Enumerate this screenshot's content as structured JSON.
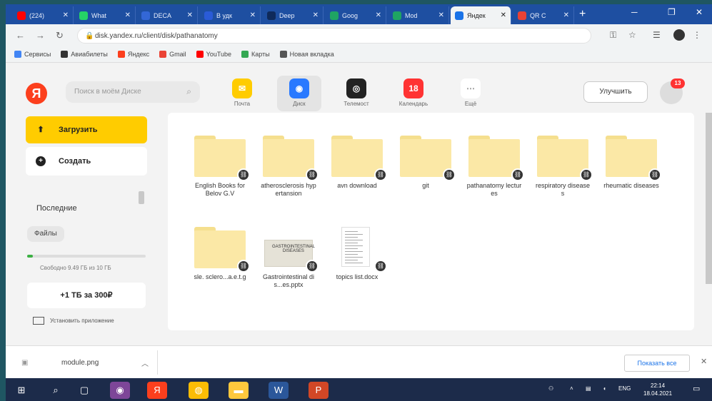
{
  "browser": {
    "tabs": [
      {
        "title": "(224)",
        "favicon_color": "#ff0000",
        "active": false
      },
      {
        "title": "What",
        "favicon_color": "#25d366",
        "active": false
      },
      {
        "title": "DECA",
        "favicon_color": "#3367d6",
        "active": false
      },
      {
        "title": "В удк",
        "favicon_color": "#2a5bd7",
        "active": false
      },
      {
        "title": "Deep",
        "favicon_color": "#0f2a5a",
        "active": false
      },
      {
        "title": "Goog",
        "favicon_color": "#1fa463",
        "active": false
      },
      {
        "title": "Mod",
        "favicon_color": "#1fa463",
        "active": false
      },
      {
        "title": "Яндек",
        "favicon_color": "#1a73e8",
        "active": true
      },
      {
        "title": "QR C",
        "favicon_color": "#e94235",
        "active": false
      }
    ],
    "new_tab_symbol": "+",
    "window_controls": {
      "minimize": "─",
      "restore": "❐",
      "close": "✕"
    },
    "url": "disk.yandex.ru/client/disk/pathanatomy",
    "bookmarks": [
      {
        "label": "Сервисы",
        "icon": "grid-icon",
        "color": "#4285f4"
      },
      {
        "label": "Авиабилеты",
        "icon": "plane-icon",
        "color": "#333333"
      },
      {
        "label": "Яндекс",
        "icon": "yandex-icon",
        "color": "#fc3f1d"
      },
      {
        "label": "Gmail",
        "icon": "gmail-icon",
        "color": "#ea4335"
      },
      {
        "label": "YouTube",
        "icon": "youtube-icon",
        "color": "#ff0000"
      },
      {
        "label": "Карты",
        "icon": "maps-icon",
        "color": "#34a853"
      },
      {
        "label": "Новая вкладка",
        "icon": "globe-icon",
        "color": "#555555"
      }
    ]
  },
  "header": {
    "logo": "Я",
    "search_placeholder": "Поиск в моём Диске",
    "services": [
      {
        "label": "Почта",
        "icon": "mail-icon",
        "color": "#ffcc00",
        "active": false
      },
      {
        "label": "Диск",
        "icon": "disk-icon",
        "color": "#2979ff",
        "active": true
      },
      {
        "label": "Телемост",
        "icon": "telemost-icon",
        "color": "#222222",
        "active": false
      },
      {
        "label": "Календарь",
        "icon": "calendar-icon",
        "color": "#f33",
        "badge": "18",
        "active": false
      },
      {
        "label": "Ещё",
        "icon": "more-icon",
        "color": "#ffffff",
        "active": false
      }
    ],
    "improve_button": "Улучшить",
    "avatar_badge": "13"
  },
  "sidebar": {
    "upload": "Загрузить",
    "create": "Создать",
    "recent": "Последние",
    "files": "Файлы",
    "storage_text": "Свободно 9.49 ГБ из 10 ГБ",
    "storage_used_fraction": 0.05,
    "storage_color": "#3cb043",
    "buy_more": "+1 ТБ за 300₽",
    "install_app": "Установить приложение"
  },
  "files": [
    {
      "type": "folder",
      "name": "English Books for Belov G.V"
    },
    {
      "type": "folder",
      "name": "atherosclerosis hypertansion"
    },
    {
      "type": "folder",
      "name": "avn download"
    },
    {
      "type": "folder",
      "name": "git"
    },
    {
      "type": "folder",
      "name": "pathanatomy lectures"
    },
    {
      "type": "folder",
      "name": "respiratory diseases"
    },
    {
      "type": "folder",
      "name": "rheumatic diseases"
    },
    {
      "type": "folder",
      "name": "sle. sclero...a.e.t.g"
    },
    {
      "type": "pptx",
      "name": "Gastrointestinal dis...es.pptx",
      "preview_text": "GASTROINTESTINAL DISEASES"
    },
    {
      "type": "docx",
      "name": "topics list.docx"
    }
  ],
  "download_bar": {
    "file": "module.png",
    "show_all": "Показать все"
  },
  "taskbar": {
    "apps": [
      "windows-icon",
      "search-icon",
      "taskview-icon",
      "tor-icon",
      "yandex-browser-icon",
      "chrome-icon",
      "explorer-icon",
      "word-icon",
      "powerpoint-icon"
    ],
    "language": "ENG",
    "time": "22:14",
    "date": "18.04.2021"
  }
}
